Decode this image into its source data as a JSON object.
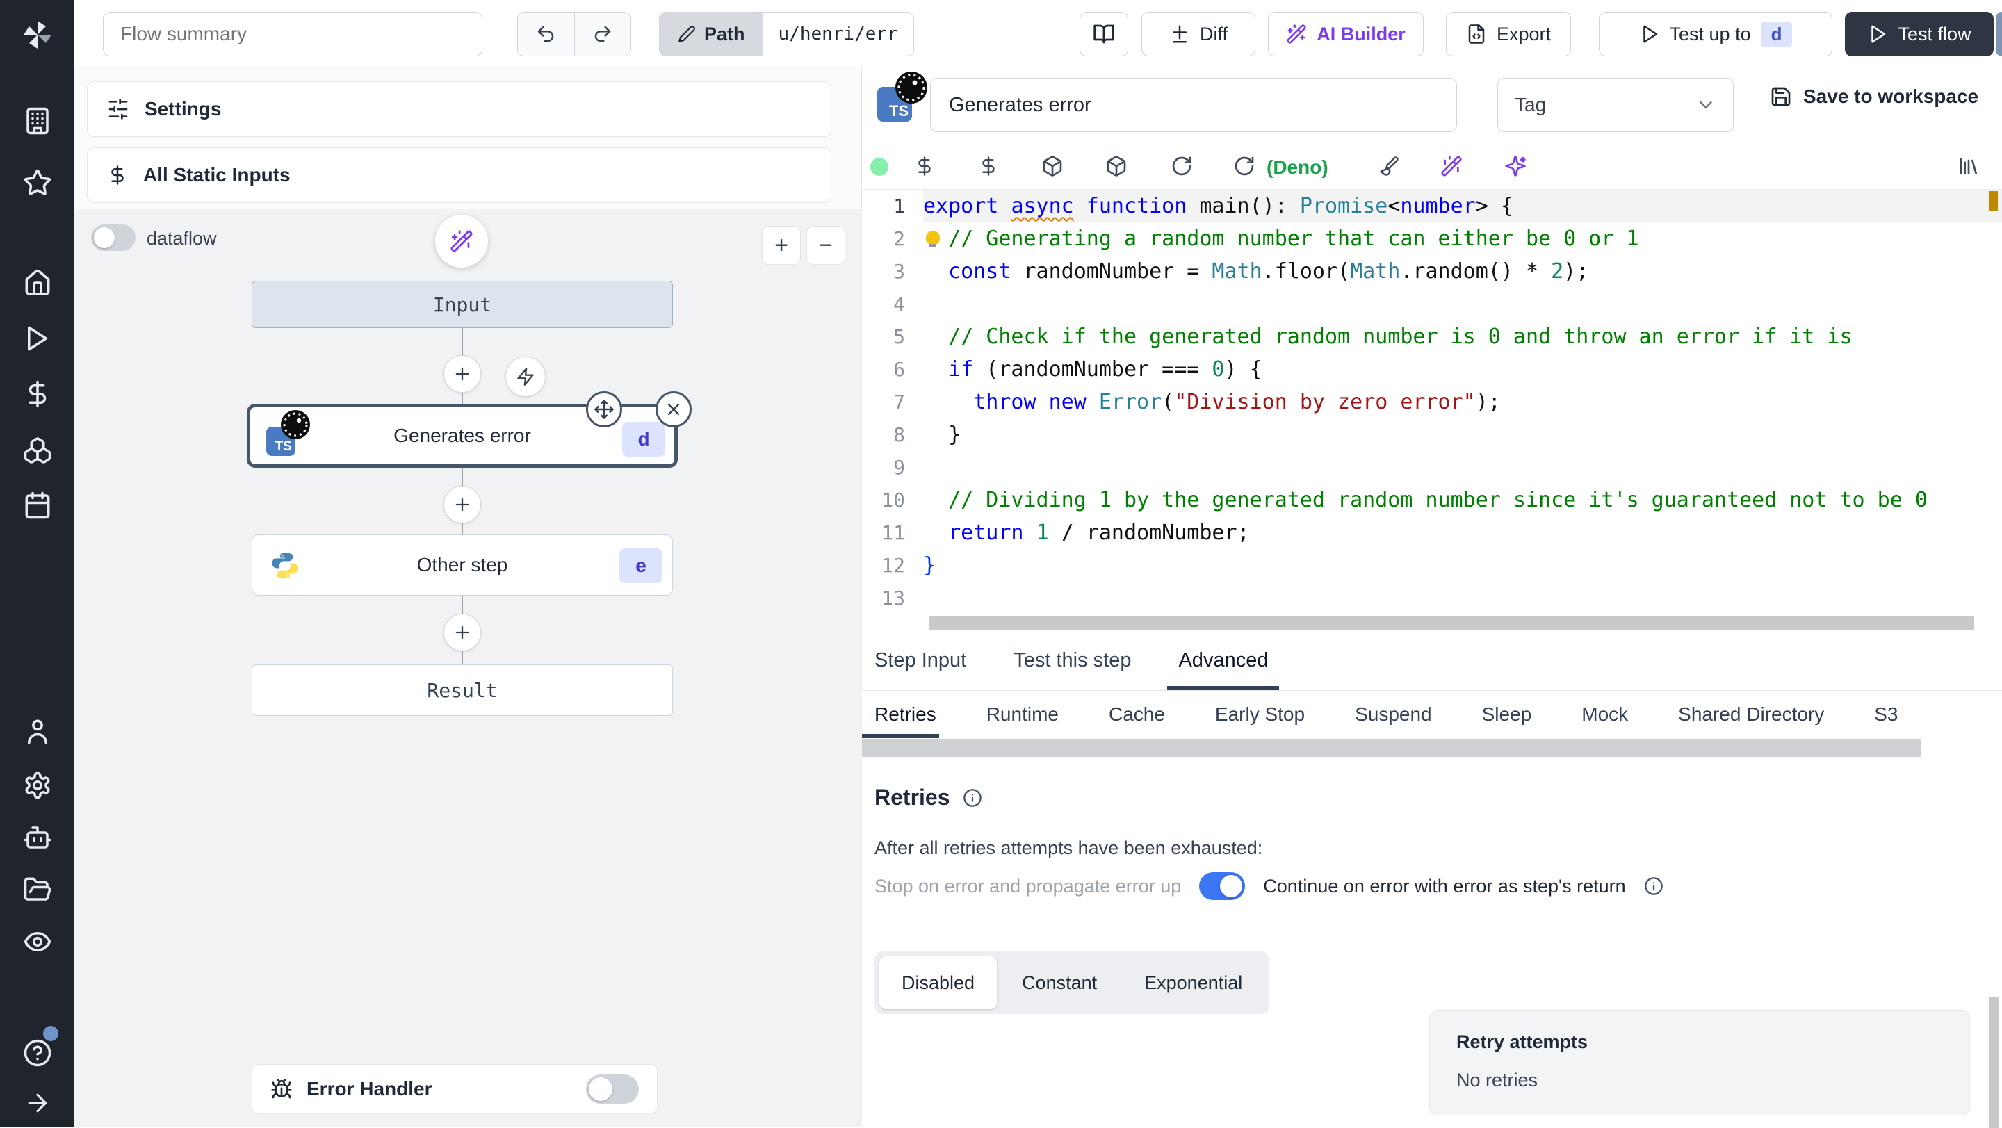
{
  "topbar": {
    "flow_summary_placeholder": "Flow summary",
    "path_label": "Path",
    "path_value": "u/henri/err",
    "diff_label": "Diff",
    "ai_builder_label": "AI Builder",
    "export_label": "Export",
    "test_up_to_label": "Test up to",
    "test_up_to_badge": "d",
    "test_flow_label": "Test flow"
  },
  "flow_panel": {
    "settings_label": "Settings",
    "all_static_inputs_label": "All Static Inputs",
    "dataflow_label": "dataflow",
    "zoom_in_label": "+",
    "zoom_out_label": "−",
    "nodes": {
      "input_label": "Input",
      "step1_label": "Generates error",
      "step1_badge": "d",
      "step2_label": "Other step",
      "step2_badge": "e",
      "result_label": "Result"
    },
    "error_handler_label": "Error Handler"
  },
  "icons": {
    "ts_label": "TS"
  },
  "step_editor": {
    "name_value": "Generates error",
    "tag_placeholder": "Tag",
    "save_label": "Save to workspace",
    "lang_label": "(Deno)"
  },
  "editor": {
    "lines": [
      {
        "n": 1,
        "current": true,
        "tokens": [
          [
            "k",
            "export "
          ],
          [
            "ksq",
            "async"
          ],
          [
            "k",
            " function "
          ],
          [
            "p",
            "main(): "
          ],
          [
            "t",
            "Promise"
          ],
          [
            "p",
            "<"
          ],
          [
            "k",
            "number"
          ],
          [
            "p",
            "> {"
          ]
        ]
      },
      {
        "n": 2,
        "bulb": true,
        "tokens": [
          [
            "p",
            "  "
          ],
          [
            "c",
            "// Generating a random number that can either be 0 or 1"
          ]
        ]
      },
      {
        "n": 3,
        "tokens": [
          [
            "p",
            "  "
          ],
          [
            "k",
            "const"
          ],
          [
            "p",
            " randomNumber = "
          ],
          [
            "t",
            "Math"
          ],
          [
            "p",
            ".floor("
          ],
          [
            "t",
            "Math"
          ],
          [
            "p",
            ".random() * "
          ],
          [
            "n",
            "2"
          ],
          [
            "p",
            ");"
          ]
        ]
      },
      {
        "n": 4,
        "tokens": []
      },
      {
        "n": 5,
        "tokens": [
          [
            "p",
            "  "
          ],
          [
            "c",
            "// Check if the generated random number is 0 and throw an error if it is"
          ]
        ]
      },
      {
        "n": 6,
        "tokens": [
          [
            "p",
            "  "
          ],
          [
            "k",
            "if"
          ],
          [
            "p",
            " (randomNumber === "
          ],
          [
            "n",
            "0"
          ],
          [
            "p",
            ") {"
          ]
        ]
      },
      {
        "n": 7,
        "tokens": [
          [
            "p",
            "    "
          ],
          [
            "k",
            "throw"
          ],
          [
            "p",
            " "
          ],
          [
            "k",
            "new"
          ],
          [
            "p",
            " "
          ],
          [
            "t",
            "Error"
          ],
          [
            "p",
            "("
          ],
          [
            "s",
            "\"Division by zero error\""
          ],
          [
            "p",
            ");"
          ]
        ]
      },
      {
        "n": 8,
        "tokens": [
          [
            "p",
            "  }"
          ]
        ]
      },
      {
        "n": 9,
        "tokens": []
      },
      {
        "n": 10,
        "tokens": [
          [
            "p",
            "  "
          ],
          [
            "c",
            "// Dividing 1 by the generated random number since it's guaranteed not to be 0"
          ]
        ]
      },
      {
        "n": 11,
        "tokens": [
          [
            "p",
            "  "
          ],
          [
            "k",
            "return"
          ],
          [
            "p",
            " "
          ],
          [
            "n",
            "1"
          ],
          [
            "p",
            " / randomNumber;"
          ]
        ]
      },
      {
        "n": 12,
        "tokens": [
          [
            "b",
            "}"
          ]
        ]
      },
      {
        "n": 13,
        "tokens": []
      }
    ]
  },
  "tabs": {
    "items": [
      "Step Input",
      "Test this step",
      "Advanced"
    ],
    "active": "Advanced"
  },
  "subtabs": {
    "items": [
      "Retries",
      "Runtime",
      "Cache",
      "Early Stop",
      "Suspend",
      "Sleep",
      "Mock",
      "Shared Directory",
      "S3"
    ],
    "active": "Retries"
  },
  "retries": {
    "title": "Retries",
    "exhausted_label": "After all retries attempts have been exhausted:",
    "stop_label": "Stop on error and propagate error up",
    "continue_label": "Continue on error with error as step's return",
    "modes": [
      "Disabled",
      "Constant",
      "Exponential"
    ],
    "active_mode": "Disabled",
    "retry_attempts_title": "Retry attempts",
    "retry_attempts_value": "No retries"
  },
  "colors": {
    "sidebar_bg": "#20242d",
    "accent_purple": "#7c3aed",
    "toggle_on_blue": "#3b76f5",
    "badge_bg": "#dbe3fd",
    "badge_text": "#4338ca",
    "deno_green": "#16a34a",
    "dark_button": "#2e3644"
  }
}
